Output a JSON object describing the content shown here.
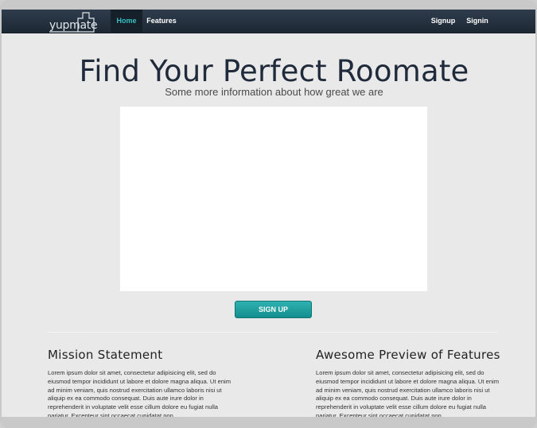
{
  "brand": {
    "logo_text": "yupmate"
  },
  "nav": {
    "left": [
      {
        "label": "Home",
        "active": true
      },
      {
        "label": "Features",
        "active": false
      }
    ],
    "right": [
      {
        "label": "Signup"
      },
      {
        "label": "Signin"
      }
    ]
  },
  "hero": {
    "title": "Find Your Perfect Roomate",
    "subtitle": "Some more information about how great we are",
    "cta_label": "SIGN UP"
  },
  "sections": [
    {
      "heading": "Mission Statement",
      "body": "Lorem ipsum dolor sit amet, consectetur adipisicing elit, sed do eiusmod tempor incididunt ut labore et dolore magna aliqua. Ut enim ad minim veniam, quis nostrud exercitation ullamco laboris nisi ut aliquip ex ea commodo consequat. Duis aute irure dolor in reprehenderit in voluptate velit esse cillum dolore eu fugiat nulla pariatur. Excepteur sint occaecat cupidatat non"
    },
    {
      "heading": "Awesome Preview of Features",
      "body": "Lorem ipsum dolor sit amet, consectetur adipisicing elit, sed do eiusmod tempor incididunt ut labore et dolore magna aliqua. Ut enim ad minim veniam, quis nostrud exercitation ullamco laboris nisi ut aliquip ex ea commodo consequat. Duis aute irure dolor in reprehenderit in voluptate velit esse cillum dolore eu fugiat nulla pariatur. Excepteur sint occaecat cupidatat non"
    }
  ],
  "colors": {
    "navbar": "#233140",
    "accent": "#37bfbf",
    "button": "#1a9e9e",
    "page_background": "#e9e9e9"
  }
}
